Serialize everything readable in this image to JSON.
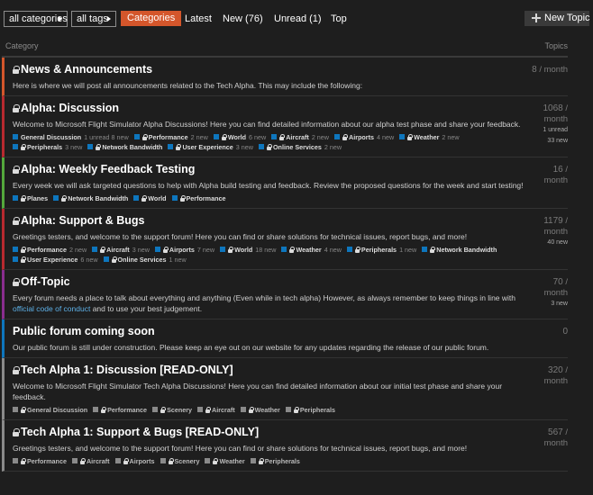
{
  "nav": {
    "category_filter": "all categories",
    "tag_filter": "all tags",
    "links": [
      "Categories",
      "Latest",
      "New (76)",
      "Unread (1)",
      "Top"
    ],
    "active_link": "Categories",
    "new_topic": "New Topic"
  },
  "table": {
    "col_category": "Category",
    "col_topics": "Topics"
  },
  "colors": {
    "accent": "#d4562b",
    "blue": "#0e76bd",
    "red": "#b8292f",
    "green": "#54a83c",
    "purple": "#8a2d8f",
    "gray": "#8a8a8a"
  },
  "categories": [
    {
      "name": "News & Announcements",
      "locked": true,
      "color": "#d4562b",
      "description": "Here is where we will post all announcements related to the Tech Alpha. This may include the following:",
      "topics": "8",
      "per": "/ month",
      "extra": [],
      "subs": []
    },
    {
      "name": "Alpha: Discussion",
      "locked": true,
      "color": "#b8292f",
      "description": "Welcome to Microsoft Flight Simulator Alpha Discussions! Here you can find detailed information about our alpha test phase and share your feedback.",
      "topics": "1068",
      "per": "/ month",
      "extra": [
        "1 unread",
        "33 new"
      ],
      "subs": [
        {
          "name": "General Discussion",
          "count": "1 unread\n8 new",
          "locked": false
        },
        {
          "name": "Performance",
          "count": "2 new",
          "locked": true
        },
        {
          "name": "World",
          "count": "6 new",
          "locked": true
        },
        {
          "name": "Aircraft",
          "count": "2 new",
          "locked": true
        },
        {
          "name": "Airports",
          "count": "4 new",
          "locked": true
        },
        {
          "name": "Weather",
          "count": "2 new",
          "locked": true
        },
        {
          "name": "Peripherals",
          "count": "3 new",
          "locked": true
        },
        {
          "name": "Network Bandwidth",
          "count": "",
          "locked": true
        },
        {
          "name": "User Experience",
          "count": "3 new",
          "locked": true
        },
        {
          "name": "Online Services",
          "count": "2 new",
          "locked": true
        }
      ]
    },
    {
      "name": "Alpha: Weekly Feedback Testing",
      "locked": true,
      "color": "#54a83c",
      "description": "Every week we will ask targeted questions to help with Alpha build testing and feedback. Review the proposed questions for the week and start testing!",
      "topics": "16",
      "per": "/ month",
      "extra": [],
      "subs": [
        {
          "name": "Planes",
          "count": "",
          "locked": true
        },
        {
          "name": "Network Bandwidth",
          "count": "",
          "locked": true
        },
        {
          "name": "World",
          "count": "",
          "locked": true
        },
        {
          "name": "Performance",
          "count": "",
          "locked": true
        }
      ]
    },
    {
      "name": "Alpha: Support & Bugs",
      "locked": true,
      "color": "#b8292f",
      "description": "Greetings testers, and welcome to the support forum! Here you can find or share solutions for technical issues, report bugs, and more!",
      "topics": "1179",
      "per": "/ month",
      "extra": [
        "40 new"
      ],
      "subs": [
        {
          "name": "Performance",
          "count": "2 new",
          "locked": true
        },
        {
          "name": "Aircraft",
          "count": "3 new",
          "locked": true
        },
        {
          "name": "Airports",
          "count": "7 new",
          "locked": true
        },
        {
          "name": "World",
          "count": "18 new",
          "locked": true
        },
        {
          "name": "Weather",
          "count": "4 new",
          "locked": true
        },
        {
          "name": "Peripherals",
          "count": "1 new",
          "locked": true
        },
        {
          "name": "Network Bandwidth",
          "count": "",
          "locked": true
        },
        {
          "name": "User Experience",
          "count": "6 new",
          "locked": true
        },
        {
          "name": "Online Services",
          "count": "1 new",
          "locked": true
        }
      ]
    },
    {
      "name": "Off-Topic",
      "locked": true,
      "color": "#8a2d8f",
      "description": "Every forum needs a place to talk about everything and anything (Even while in tech alpha) However, as always remember to keep things in line with",
      "link": "official code of conduct",
      "description_after": "and to use your best judgement.",
      "topics": "70",
      "per": "/ month",
      "extra": [
        "3 new"
      ],
      "subs": []
    },
    {
      "name": "Public forum coming soon",
      "locked": false,
      "color": "#0e76bd",
      "description": "Our public forum is still under construction. Please keep an eye out on our website for any updates regarding the release of our public forum.",
      "topics": "0",
      "per": "",
      "extra": [],
      "subs": []
    },
    {
      "name": "Tech Alpha 1: Discussion [READ-ONLY]",
      "locked": true,
      "color": "#8a8a8a",
      "description": "Welcome to Microsoft Flight Simulator Tech Alpha Discussions! Here you can find detailed information about our initial test phase and share your feedback.",
      "topics": "320",
      "per": "/ month",
      "extra": [],
      "gray_subs": true,
      "subs": [
        {
          "name": "General Discussion",
          "count": "",
          "locked": true
        },
        {
          "name": "Performance",
          "count": "",
          "locked": true
        },
        {
          "name": "Scenery",
          "count": "",
          "locked": true
        },
        {
          "name": "Aircraft",
          "count": "",
          "locked": true
        },
        {
          "name": "Weather",
          "count": "",
          "locked": true
        },
        {
          "name": "Peripherals",
          "count": "",
          "locked": true
        }
      ]
    },
    {
      "name": "Tech Alpha 1: Support & Bugs [READ-ONLY]",
      "locked": true,
      "color": "#8a8a8a",
      "description": "Greetings testers, and welcome to the support forum! Here you can find or share solutions for technical issues, report bugs, and more!",
      "topics": "567",
      "per": "/ month",
      "extra": [],
      "gray_subs": true,
      "subs": [
        {
          "name": "Performance",
          "count": "",
          "locked": true
        },
        {
          "name": "Aircraft",
          "count": "",
          "locked": true
        },
        {
          "name": "Airports",
          "count": "",
          "locked": true
        },
        {
          "name": "Scenery",
          "count": "",
          "locked": true
        },
        {
          "name": "Weather",
          "count": "",
          "locked": true
        },
        {
          "name": "Peripherals",
          "count": "",
          "locked": true
        }
      ]
    }
  ]
}
